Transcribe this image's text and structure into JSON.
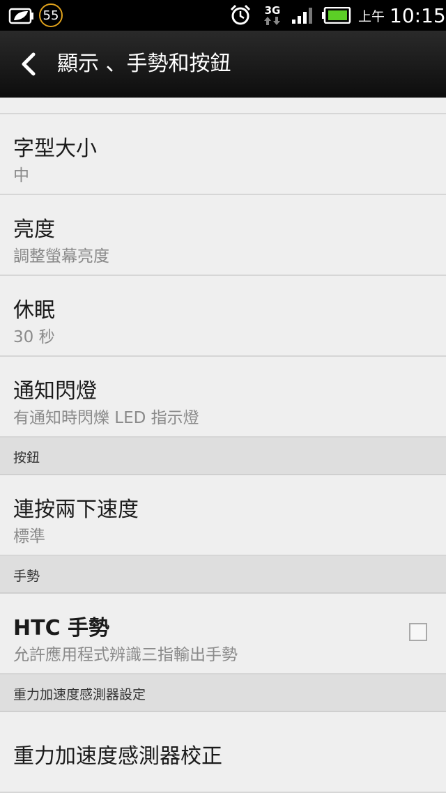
{
  "status_bar": {
    "notification_count": "55",
    "network_type": "3G",
    "time_period": "上午",
    "time": "10:15",
    "battery_color": "#5ccf26"
  },
  "header": {
    "title": "顯示 、手勢和按鈕"
  },
  "settings": [
    {
      "title": "字型大小",
      "summary": "中"
    },
    {
      "title": "亮度",
      "summary": "調整螢幕亮度"
    },
    {
      "title": "休眠",
      "summary": "30 秒"
    },
    {
      "title": "通知閃燈",
      "summary": "有通知時閃爍 LED 指示燈"
    }
  ],
  "sections": {
    "buttons": {
      "header": "按鈕",
      "items": [
        {
          "title": "連按兩下速度",
          "summary": "標準"
        }
      ]
    },
    "gestures": {
      "header": "手勢",
      "items": [
        {
          "title": "HTC 手勢",
          "summary": "允許應用程式辨識三指輸出手勢",
          "checked": false
        }
      ]
    },
    "gsensor": {
      "header": "重力加速度感測器設定",
      "items": [
        {
          "title": "重力加速度感測器校正"
        }
      ]
    }
  }
}
